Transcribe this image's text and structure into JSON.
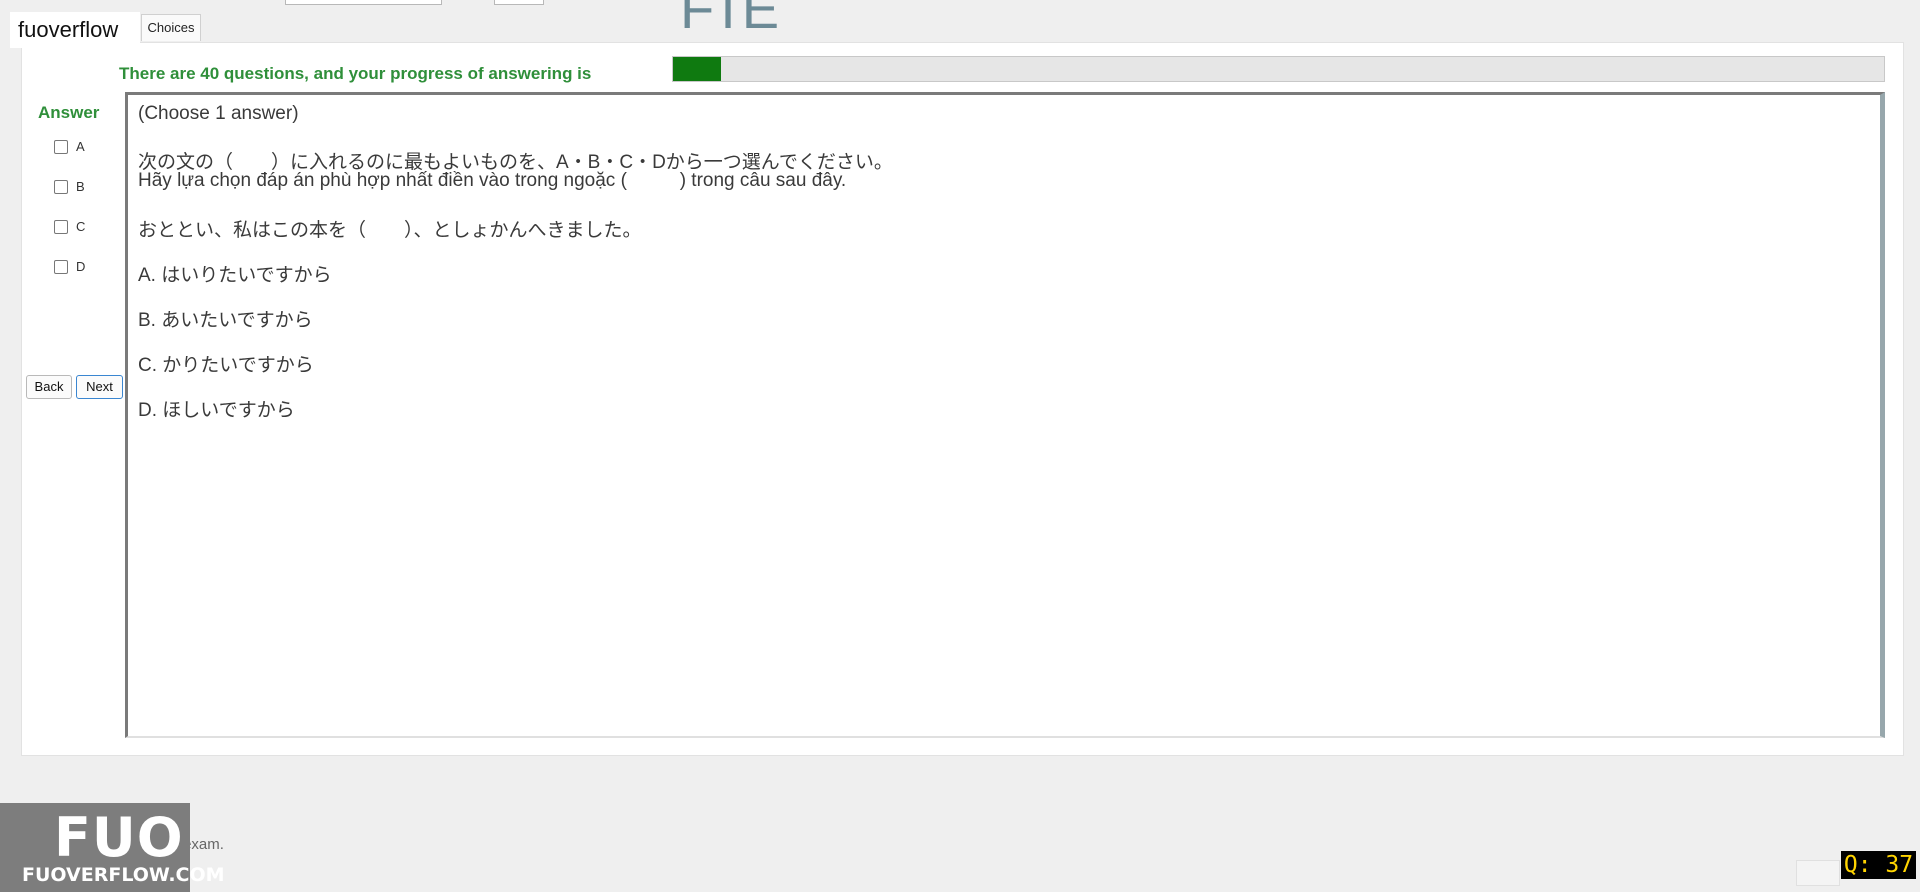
{
  "header": {
    "watermark_text": "fuoverflow",
    "tab_label": "Choices",
    "title_fragment": "FIE"
  },
  "progress": {
    "label": "There are 40 questions, and your progress of answering is",
    "fraction": 0.04,
    "fill_color": "#0f7a10"
  },
  "answer_panel": {
    "title": "Answer",
    "options": [
      "A",
      "B",
      "C",
      "D"
    ],
    "back_label": "Back",
    "next_label": "Next"
  },
  "question": {
    "instruction": "(Choose 1 answer)",
    "prompt_jp": "次の文の（　　）に入れるのに最もよいものを、A・B・C・Dから一つ選んでください。",
    "prompt_vi": "Hãy lựa chọn đáp án phù hợp nhất điền vào trong ngoặc (          ) trong câu sau đây.",
    "sentence": "おととい、私はこの本を（　　）、としょかんへきました。",
    "options": [
      "A. はいりたいですから",
      "B. あいたいですから",
      "C. かりたいですから",
      "D. ほしいですから"
    ]
  },
  "footer": {
    "finish_text": "I want to finish the exam.",
    "logo_mark": "FUO",
    "logo_site": "FUOVERFLOW.COM",
    "question_counter": "Q: 37"
  },
  "colors": {
    "accent_green": "#2f8f3a",
    "counter_bg": "#000000",
    "counter_fg": "#ffd400"
  }
}
